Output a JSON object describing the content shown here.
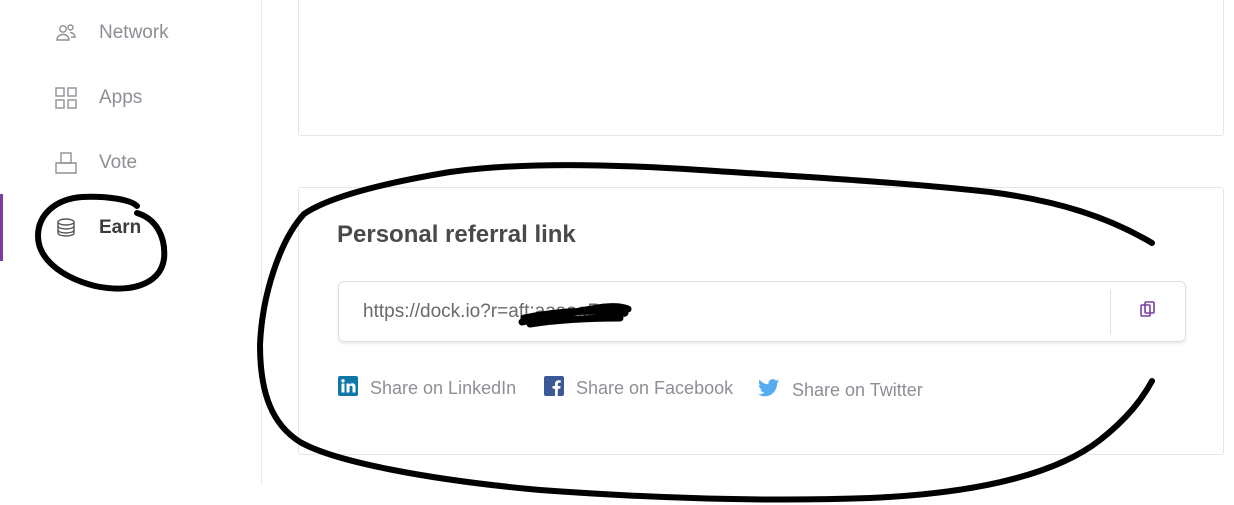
{
  "sidebar": {
    "items": [
      {
        "label": "Network",
        "icon": "network-users-icon"
      },
      {
        "label": "Apps",
        "icon": "apps-grid-icon"
      },
      {
        "label": "Vote",
        "icon": "vote-box-icon"
      },
      {
        "label": "Earn",
        "icon": "coins-stack-icon",
        "active": true
      }
    ]
  },
  "referral": {
    "title": "Personal referral link",
    "link_value": "https://dock.io?r=aft:aaaaoRUa",
    "copy_icon": "copy-icon",
    "share": [
      {
        "label": "Share on LinkedIn",
        "icon": "linkedin-icon",
        "color": "#0e76a8"
      },
      {
        "label": "Share on Facebook",
        "icon": "facebook-icon",
        "color": "#3b5998"
      },
      {
        "label": "Share on Twitter",
        "icon": "twitter-icon",
        "color": "#55acee"
      }
    ]
  },
  "colors": {
    "accent": "#7b3fa0",
    "muted_text": "#8e8e96",
    "border": "#e6e6ea"
  }
}
